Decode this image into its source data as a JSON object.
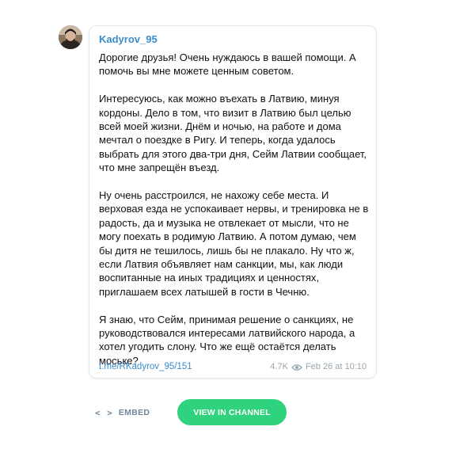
{
  "post": {
    "author": "Kadyrov_95",
    "paragraphs": [
      "Дорогие друзья! Очень нуждаюсь в вашей помощи. А помочь вы мне можете ценным советом.",
      "Интересуюсь, как можно въехать в Латвию, минуя кордоны. Дело в том, что визит в Латвию был целью всей моей жизни. Днём и ночью, на работе и дома мечтал о поездке в Ригу. И теперь, когда удалось выбрать для этого два-три дня, Сейм Латвии сообщает, что мне запрещён въезд.",
      "Ну очень расстроился, не нахожу себе места. И верховая езда не успокаивает нервы, и тренировка не в радость, да и музыка не отвлекает от мысли, что не могу поехать в родимую Латвию. А потом думаю, чем бы дитя не тешилось, лишь бы не плакало. Ну что ж, если Латвия объявляет нам санкции, мы, как люди воспитанные на иных традициях и ценностях, приглашаем всех латышей в гости в Чечню.",
      "Я знаю, что Сейм, принимая решение о санкциях, не руководствовался интересами латвийского народа, а хотел угодить слону. Что же ещё остаётся делать моське?"
    ],
    "link": "t.me/RKadyrov_95/151",
    "views": "4.7K",
    "date": "Feb 26 at 10:10"
  },
  "actions": {
    "embed_icon": "< >",
    "embed_label": "EMBED",
    "view_label": "VIEW IN CHANNEL"
  },
  "colors": {
    "accent": "#3a8ccb",
    "button": "#2fd27d",
    "muted": "#9aa5ae"
  },
  "icons": {
    "avatar": "avatar-image",
    "views": "eye-icon",
    "embed": "code-icon"
  }
}
